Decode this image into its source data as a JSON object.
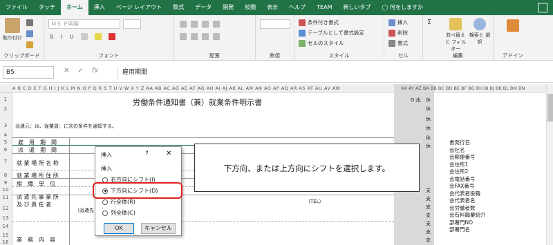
{
  "ribbon_tabs": [
    "ファイル",
    "タッチ",
    "ホーム",
    "挿入",
    "ページ レイアウト",
    "数式",
    "データ",
    "開発",
    "校閲",
    "表示",
    "ヘルプ",
    "TEAM",
    "新しいタブ",
    "何をしますか"
  ],
  "active_tab": "ホーム",
  "ribbon": {
    "clipboard": {
      "paste": "貼り付け",
      "label": "クリップボード"
    },
    "font": {
      "name": "ＭＳ Ｐ明朝",
      "label": "フォント"
    },
    "alignment": {
      "label": "配置"
    },
    "number": {
      "label": "数値"
    },
    "styles": {
      "conditional": "条件付き書式",
      "table": "テーブルとして書式設定",
      "cell": "セルのスタイル",
      "label": "スタイル"
    },
    "cells": {
      "insert": "挿入",
      "delete": "削除",
      "format": "書式",
      "label": "セル"
    },
    "editing": {
      "sort": "並べ替えと フィルター",
      "find": "検索と 選択",
      "label": "編集"
    },
    "addin": {
      "label": "アドイン"
    }
  },
  "formula_bar": {
    "name_box": "B5",
    "formula": "雇用期間"
  },
  "column_header": "A B C D E F G H I J K L M N O P Q R S T U V W X Y Z AA AB AC AD AE AF AG AH AI AJ AK AL AM AN AO AP AQ AR AS AT AU AV AW",
  "right_headers": "AX AY AZ BA BB BC BD BE BF BG BH BI BJ BK BL BM BN",
  "rows": [
    "1",
    "2",
    "3",
    "4",
    "5",
    "6",
    "7",
    "8",
    "9",
    "10",
    "11",
    "12",
    "13",
    "14",
    "15",
    "16"
  ],
  "sheet": {
    "title": "労働条件通知書（兼）就業条件明示書",
    "intro": "派遣元：は、従業員：に次の条件を通知する。",
    "r5": "雇　用　期　間",
    "r6": "派　遣　期　間",
    "r7": "就 業 場 所 名 称",
    "r8": "就 業 場 所 住 所",
    "r9": "組　織　単　位",
    "r11a": "派 遣 先 事 業 所",
    "r11b": "及 び 責 任 者",
    "r12": "（派遣先",
    "tel": "（TEL）",
    "r15": "業　務　内　容",
    "right_top": "D:出",
    "right_col_a": [
      "休",
      "休",
      "休",
      "休",
      "休",
      "休",
      "",
      "支",
      "支",
      "支",
      "支",
      "支",
      "支",
      "支",
      "支",
      "支"
    ],
    "right_col_b": [
      "書発行日",
      "会社名",
      "会郵便番号",
      "会住所1",
      "会住所2",
      "会電話番号",
      "会FAX番号",
      "会代表者役職",
      "会代表者名",
      "会労働者数",
      "会有料職業紹介",
      "部署門NO",
      "部署門名"
    ]
  },
  "dialog": {
    "title": "挿入",
    "help": "?",
    "close": "✕",
    "section": "挿入",
    "options": [
      "右方向にシフト(I)",
      "下方向にシフト(D)",
      "行全体(R)",
      "列全体(C)"
    ],
    "selected": 1,
    "ok": "OK",
    "cancel": "キャンセル"
  },
  "callout": "下方向、または上方向にシフトを選択します。"
}
